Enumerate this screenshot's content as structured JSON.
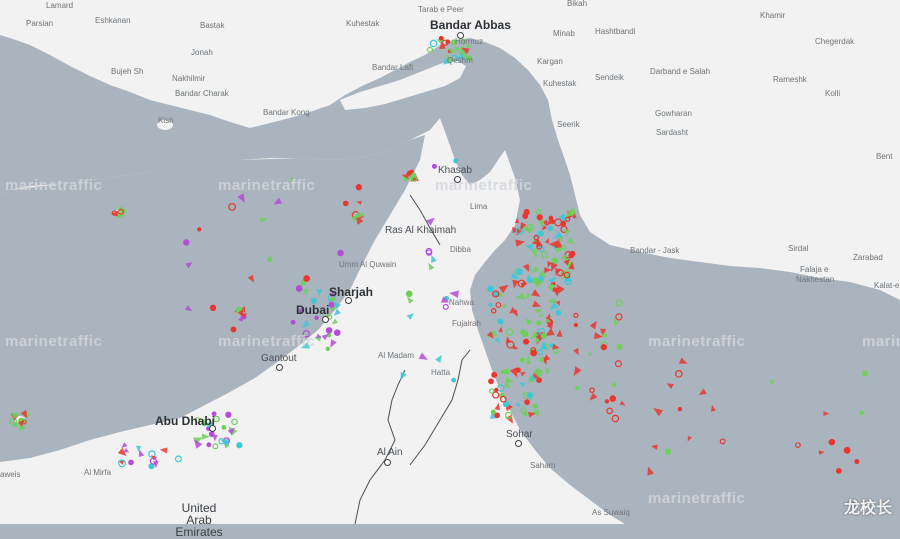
{
  "colors": {
    "water": "#aab4bf",
    "land": "#f2f2f2",
    "cargo": "#e8372e",
    "tanker": "#e8372e",
    "green": "#6fcf5a",
    "cyan": "#3cc8d6",
    "purple": "#b44cd6"
  },
  "labels": {
    "lamard": "Lamard",
    "parsian": "Parsian",
    "eshkanan": "Eshkanan",
    "bastak": "Bastak",
    "khamir": "Khamir",
    "kuhestak": "Kuhestak",
    "bandar_abbas": "Bandar Abbas",
    "hormuz": "Hormuz",
    "minab": "Minab",
    "bikah": "Bikah",
    "hashtbandi": "Hashtbandi",
    "chegerdak": "Chegerdak",
    "jonah": "Jonah",
    "bandar_laft": "Bandar Laft",
    "qeshm": "Qeshm",
    "kargan": "Kargan",
    "kuhestak2": "Kuhestak",
    "sendeik": "Sendeik",
    "darband_salah": "Darband e Salah",
    "rameshk": "Rameshk",
    "buje_sh": "Bujeh Sh",
    "nakhilmir": "Nakhilmir",
    "bandar_charak": "Bandar Charak",
    "bandar_kong": "Bandar Kong",
    "kish": "Kish",
    "seerik": "Seerik",
    "gowharan": "Gowharan",
    "sardasht": "Sardasht",
    "kolli": "Kolli",
    "bent": "Bent",
    "khasab": "Khasab",
    "lima": "Lima",
    "ras_al_khaimah": "Ras Al Khaimah",
    "dibba": "Dibba",
    "bandar_e_jask": "Bandar - Jask",
    "sirdal": "Sirdal",
    "zarabad": "Zarabad",
    "kalat": "Kalat-e",
    "falaja": "Falaja e",
    "nakhestan": "Nakhestan",
    "umm_al_quwain": "Umm Al Quwain",
    "sharjah": "Sharjah",
    "dubai": "Dubai",
    "nahwa": "Nahwa",
    "fujairah": "Fujairah",
    "gantout": "Gantout",
    "al_madam": "Al Madam",
    "hatta": "Hatta",
    "abu_dhabi": "Abu Dhabi",
    "al_ain": "Al Ain",
    "sohar": "Sohar",
    "saham": "Saham",
    "al_mirfa": "Al Mirfa",
    "alwais": "aweis",
    "uae": "United Arab Emirates",
    "as_suwaiq": "As Suwaiq",
    "watermark": "marinetraffic",
    "corner_watermark": "龙校长",
    "kuhestak_top": "Kuhestak",
    "tarab_yepeer": "Tarab e Peer"
  }
}
